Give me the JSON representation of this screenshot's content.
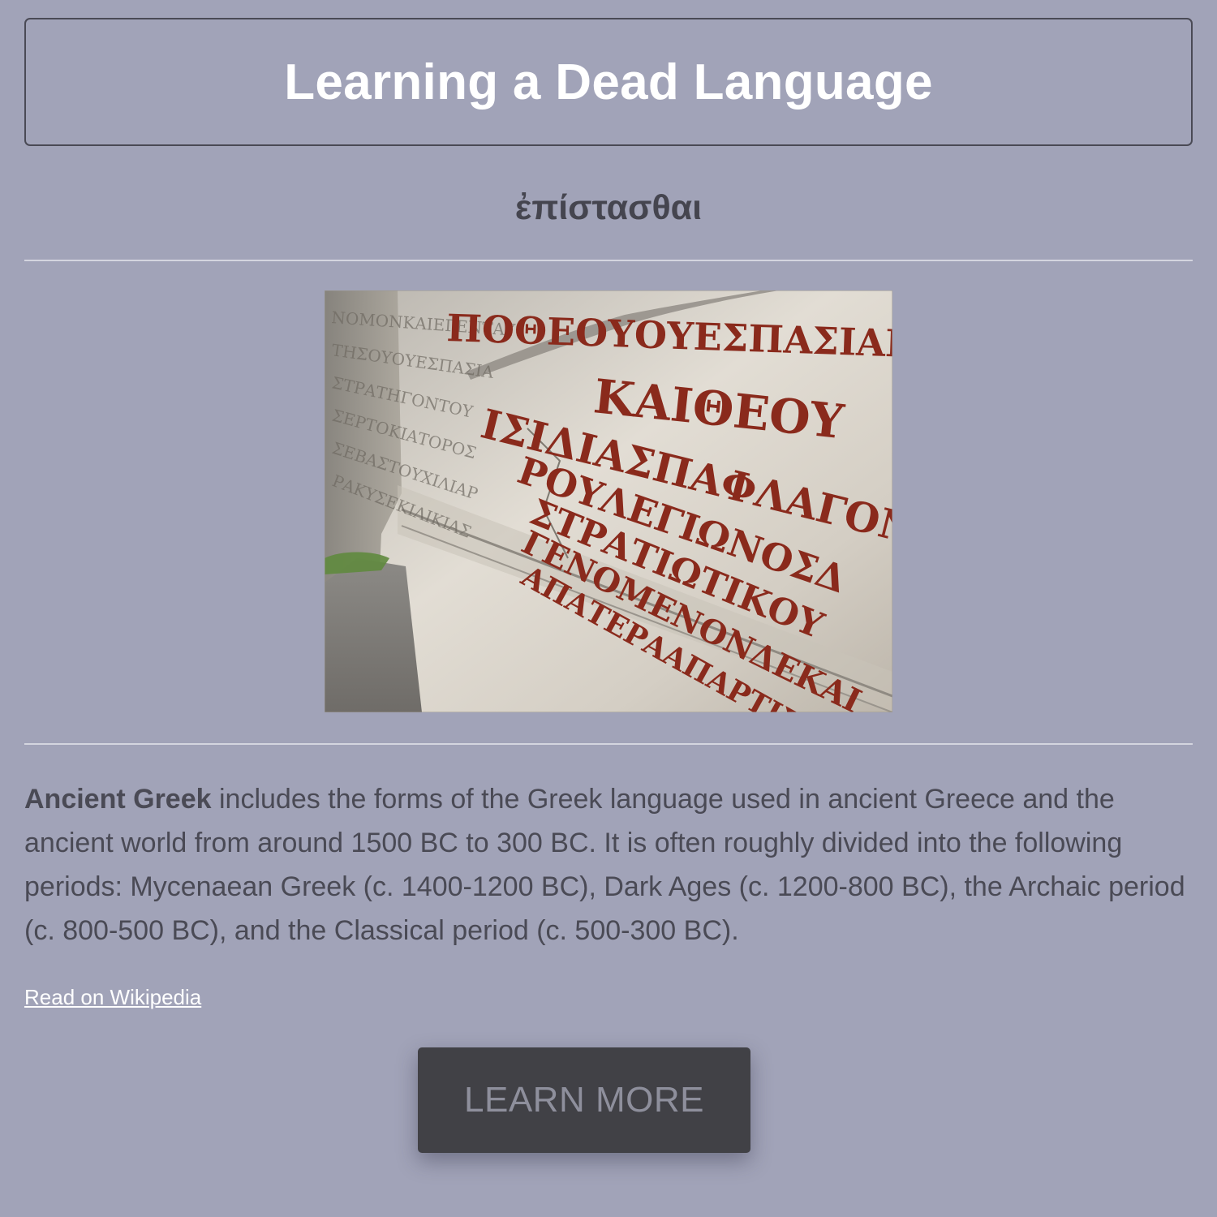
{
  "header": {
    "title": "Learning a Dead Language"
  },
  "subtitle": "ἐπίστασθαι",
  "image": {
    "alt": "Ancient Greek inscription carved in marble",
    "inscription_lines": [
      "ΠΟΘΕΟΥΟΥΕΣΠΑΣΙΑΝΟΥ",
      "ΚΑΙΘΕΟΥ",
      "ΙΣΙΔΙΑΣΠΑΦΛΑΓΟΝΙΑΣ",
      "ΡΟΥΛΕΓΙΩΝΟΣΔ",
      "ΣΤΡΑΤΙΩΤΙΚΟΥ",
      "ΓΕΝΟΜΕΝΟΝΔΕΚΑΙ",
      "ΑΠΑΤΕΡΑΑΠΑΡΤΙΣΑ"
    ]
  },
  "description": {
    "term": "Ancient Greek",
    "text": " includes the forms of the Greek language used in ancient Greece and the ancient world from around 1500 BC to 300 BC. It is often roughly divided into the following periods: Mycenaean Greek (c. 1400-1200 BC), Dark Ages (c. 1200-800 BC), the Archaic period (c. 800-500 BC), and the Classical period (c. 500-300 BC)."
  },
  "link": {
    "label": "Read on Wikipedia"
  },
  "cta": {
    "label": "LEARN MORE"
  },
  "colors": {
    "background": "#a1a3b8",
    "title_text": "#ffffff",
    "body_text": "#4a4a55",
    "button_bg": "#414146",
    "button_text": "#8e8f9c",
    "inscription_red": "#8a2a1c"
  }
}
